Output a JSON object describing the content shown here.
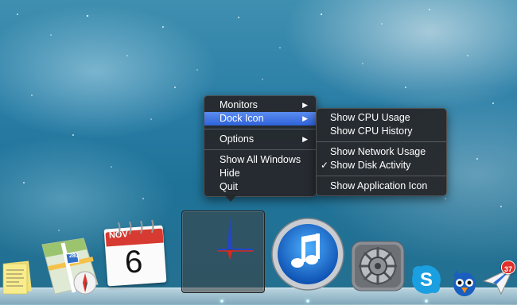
{
  "main_menu": {
    "items": [
      {
        "label": "Monitors",
        "has_submenu": true
      },
      {
        "label": "Dock Icon",
        "has_submenu": true,
        "highlighted": true
      },
      {
        "label": "Options",
        "has_submenu": true
      },
      {
        "label": "Show All Windows"
      },
      {
        "label": "Hide"
      },
      {
        "label": "Quit"
      }
    ]
  },
  "sub_menu": {
    "items": [
      {
        "label": "Show CPU Usage",
        "checked": false
      },
      {
        "label": "Show CPU History",
        "checked": false
      },
      {
        "label": "Show Network Usage",
        "checked": false
      },
      {
        "label": "Show Disk Activity",
        "checked": true
      },
      {
        "label": "Show Application Icon",
        "checked": false
      }
    ]
  },
  "glyphs": {
    "arrow": "▶",
    "check": "✓"
  },
  "dock": {
    "apps": [
      {
        "name": "stickies-icon"
      },
      {
        "name": "maps-icon",
        "label": "280"
      },
      {
        "name": "calendar-icon",
        "month": "NOV",
        "day": "6"
      },
      {
        "name": "activity-monitor-icon",
        "active": true
      },
      {
        "name": "itunes-icon"
      },
      {
        "name": "system-preferences-icon"
      },
      {
        "name": "skype-icon"
      },
      {
        "name": "tweetbot-icon"
      },
      {
        "name": "mail-sender-icon",
        "badge": "37"
      }
    ]
  },
  "colors": {
    "highlight": "#2e62d9",
    "menu_bg": "#262628",
    "badge": "#e0302a",
    "calendar_red": "#d63a30",
    "itunes_blue": "#1a6fd6",
    "skype_blue": "#1aa0e0"
  }
}
